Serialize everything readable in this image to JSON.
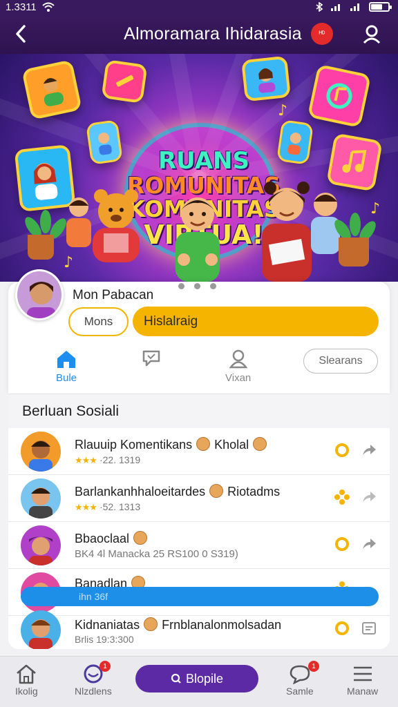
{
  "status_bar": {
    "time": "1.3311"
  },
  "header": {
    "title": "Almoramara Ihidarasia",
    "notification_label": "ᴴᴰ"
  },
  "hero": {
    "title_lines": [
      "RUANS",
      "ROMUNITAS",
      "KOMUNITAS",
      "VIRTUA!"
    ],
    "colors": {
      "line1": "#3ef3c2",
      "line2": "#ff8a2a",
      "line3": "#ffd23a",
      "line4": "#ffe44a"
    }
  },
  "profile": {
    "name": "Mon Pabacan",
    "outline_button": "Mons",
    "primary_button": "Hislalraig",
    "tabs": [
      {
        "label": "Bule",
        "icon": "home-icon",
        "active": true
      },
      {
        "label": "",
        "icon": "chat-icon",
        "active": false
      },
      {
        "label": "Vixan",
        "icon": "user-icon",
        "active": false
      }
    ],
    "settings_button": "Slearans"
  },
  "section": {
    "title": "Berluan Sosiali"
  },
  "list": [
    {
      "title_a": "Rlauuip Komentikans",
      "title_b": "Kholal",
      "stars": "★★★",
      "sub": "·22. 1319",
      "gear_icon": "gear-icon",
      "action_icon": "share-icon"
    },
    {
      "title_a": "Barlankanhhaloeitardes",
      "title_b": "Riotadms",
      "stars": "★★★",
      "sub": "·52. 1313",
      "gear_icon": "flower-icon",
      "action_icon": "share-icon"
    },
    {
      "title_a": "Bbaoclaal",
      "title_b": "",
      "stars": "",
      "sub": "BK4 4l Manacka 25 RS100 0 S319)",
      "gear_icon": "gear-icon",
      "action_icon": "share-icon"
    },
    {
      "title_a": "Banadlan",
      "title_b": "",
      "stars": "",
      "sub": "",
      "gear_icon": "flower-icon",
      "action_icon": "share-icon"
    },
    {
      "title_a": "Kidnaniatas",
      "title_b": "Frnblanalonmolsadan",
      "stars": "",
      "sub": "Brlis 19:3:300",
      "gear_icon": "gear-icon",
      "action_icon": "message-icon"
    }
  ],
  "blue_bar": {
    "label": "ihn 36f"
  },
  "bottom_nav": {
    "items": [
      {
        "label": "Ikolig",
        "icon": "home-icon",
        "badge": ""
      },
      {
        "label": "Nlzdlens",
        "icon": "notification-icon",
        "badge": "1"
      },
      {
        "label": "Samle",
        "icon": "chat-bubble-icon",
        "badge": "1"
      },
      {
        "label": "Manaw",
        "icon": "menu-icon",
        "badge": ""
      }
    ],
    "cta_label": "Blopile"
  },
  "colors": {
    "accent_purple": "#5b2aa4",
    "accent_yellow": "#f5b400",
    "accent_blue": "#1e8fe8",
    "header_bg": "#3a1a5e"
  }
}
